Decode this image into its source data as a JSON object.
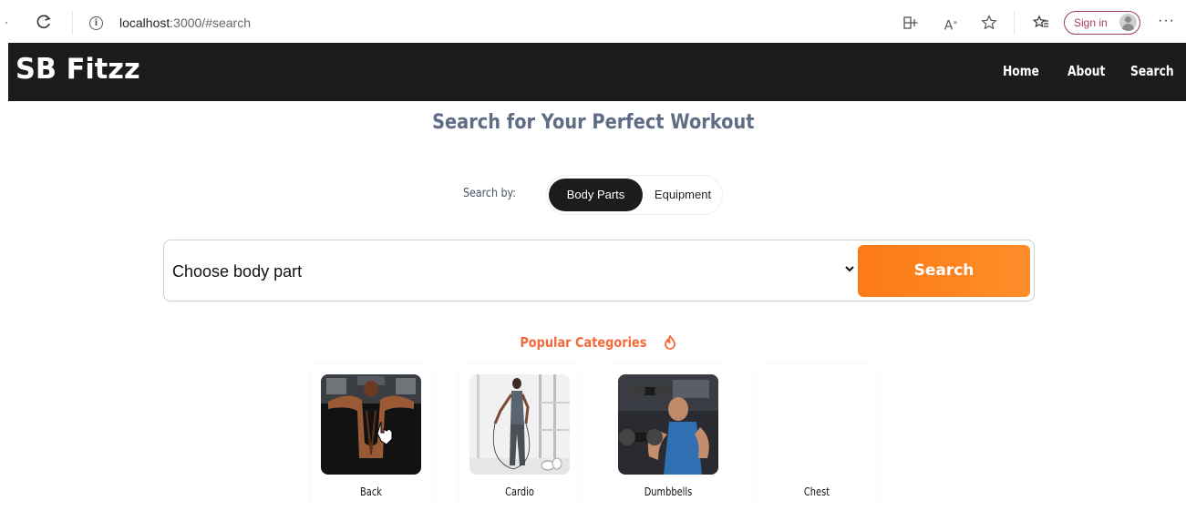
{
  "browser": {
    "url_host": "localhost",
    "url_path": ":3000/#search",
    "sign_in_label": "Sign in",
    "more_label": "···"
  },
  "nav": {
    "logo": "SB Fitzz",
    "links": [
      "Home",
      "About",
      "Search"
    ]
  },
  "page": {
    "heading": "Search for Your Perfect Workout",
    "search_by_label": "Search by:",
    "toggle": {
      "options": [
        "Body Parts",
        "Equipment"
      ],
      "selected": "Body Parts"
    },
    "select": {
      "value": "Choose body part"
    },
    "search_button": "Search",
    "popular_title": "Popular Categories",
    "categories": [
      {
        "label": "Back",
        "image": "back-workout-photo"
      },
      {
        "label": "Cardio",
        "image": "cardio-jump-rope-photo"
      },
      {
        "label": "Dumbbells",
        "image": "dumbbell-curl-photo"
      },
      {
        "label": "Chest",
        "image": "blank"
      }
    ]
  },
  "colors": {
    "nav_bg": "#1c1c1c",
    "accent_orange": "#fb7a16",
    "popular_title": "#f46a3b",
    "heading": "#5e6d85"
  }
}
